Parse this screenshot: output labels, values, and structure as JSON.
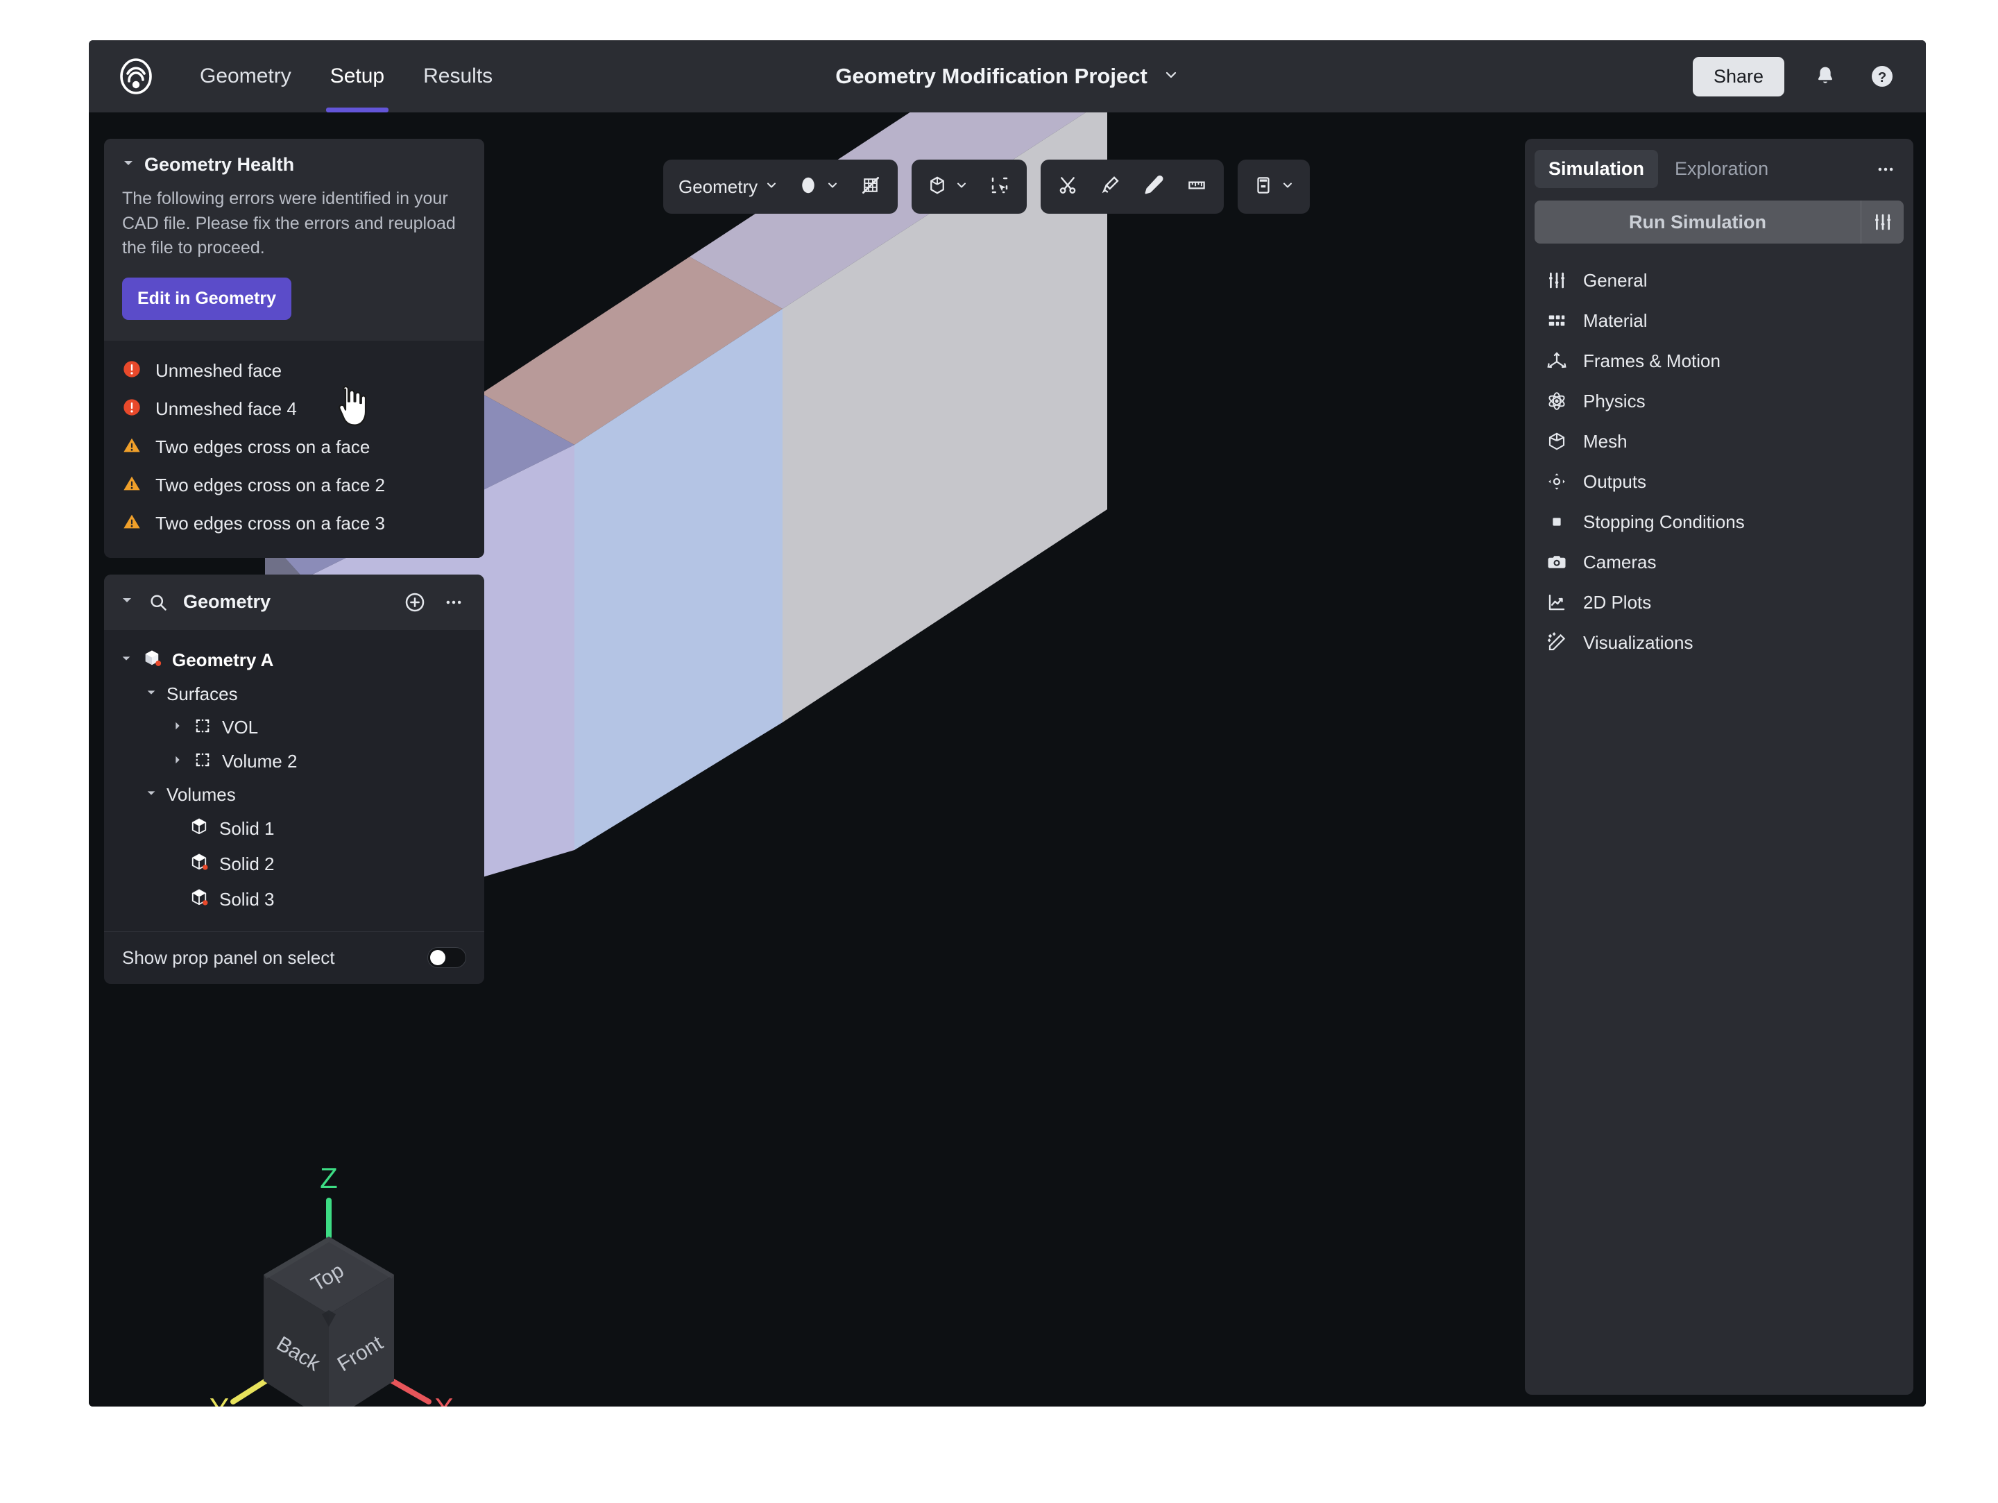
{
  "topbar": {
    "logo_icon": "luminary-logo-icon",
    "tabs": [
      {
        "label": "Geometry",
        "active": false
      },
      {
        "label": "Setup",
        "active": true
      },
      {
        "label": "Results",
        "active": false
      }
    ],
    "project_title": "Geometry Modification Project",
    "project_chevron_icon": "chevron-down-icon",
    "share_label": "Share",
    "bell_icon": "notification-bell-icon",
    "help_icon": "help-circle-icon"
  },
  "toolbar": {
    "groups": [
      {
        "items": [
          {
            "type": "dropdown",
            "label": "Geometry",
            "icon": "chevron-down-icon",
            "name": "geometry-mode-dropdown"
          },
          {
            "type": "dropdown",
            "label": "",
            "icon": "sphere-shading-icon",
            "name": "shading-mode-dropdown"
          },
          {
            "type": "button",
            "label": "",
            "icon": "mesh-off-icon",
            "name": "toggle-mesh-button"
          }
        ]
      },
      {
        "items": [
          {
            "type": "dropdown",
            "label": "",
            "icon": "volume-select-icon",
            "name": "selection-type-dropdown"
          },
          {
            "type": "button",
            "label": "",
            "icon": "box-select-icon",
            "name": "box-select-button"
          }
        ]
      },
      {
        "items": [
          {
            "type": "button",
            "label": "",
            "icon": "scissors-icon",
            "name": "cut-tool-button"
          },
          {
            "type": "button",
            "label": "",
            "icon": "knife-icon",
            "name": "knife-tool-button"
          },
          {
            "type": "button",
            "label": "",
            "icon": "pen-icon",
            "name": "pen-tool-button"
          },
          {
            "type": "button",
            "label": "",
            "icon": "ruler-icon",
            "name": "measure-tool-button"
          }
        ]
      },
      {
        "items": [
          {
            "type": "dropdown",
            "label": "",
            "icon": "clip-plane-icon",
            "name": "clip-plane-dropdown"
          }
        ]
      }
    ]
  },
  "geometry_health": {
    "collapse_icon": "caret-down-icon",
    "title": "Geometry Health",
    "description": "The following errors were identified in your CAD file. Please fix the errors and reupload the file to proceed.",
    "edit_button_label": "Edit in Geometry",
    "edit_button_color": "#5b4cc9",
    "error_color": "#e8492b",
    "warning_color": "#f0a02a",
    "issues": [
      {
        "severity": "error",
        "icon": "error-circle-icon",
        "label": "Unmeshed face"
      },
      {
        "severity": "error",
        "icon": "error-circle-icon",
        "label": "Unmeshed face 4"
      },
      {
        "severity": "warning",
        "icon": "warning-triangle-icon",
        "label": "Two edges cross on a face"
      },
      {
        "severity": "warning",
        "icon": "warning-triangle-icon",
        "label": "Two edges cross on a face 2"
      },
      {
        "severity": "warning",
        "icon": "warning-triangle-icon",
        "label": "Two edges cross on a face 3"
      }
    ]
  },
  "geometry_panel": {
    "collapse_icon": "caret-down-icon",
    "search_icon": "search-icon",
    "title": "Geometry",
    "add_icon": "plus-circle-icon",
    "more_icon": "ellipsis-icon",
    "tree": [
      {
        "label": "Geometry A",
        "depth": 0,
        "caret": "down",
        "icon": "solid-cube-icon",
        "badge": true,
        "bold": true
      },
      {
        "label": "Surfaces",
        "depth": 1,
        "caret": "down",
        "icon": "",
        "badge": false,
        "bold": false
      },
      {
        "label": "VOL",
        "depth": 2,
        "caret": "right",
        "icon": "surface-group-icon",
        "badge": false,
        "bold": false
      },
      {
        "label": "Volume 2",
        "depth": 2,
        "caret": "right",
        "icon": "surface-group-icon",
        "badge": false,
        "bold": false
      },
      {
        "label": "Volumes",
        "depth": 1,
        "caret": "down",
        "icon": "",
        "badge": false,
        "bold": false
      },
      {
        "label": "Solid 1",
        "depth": 2,
        "caret": "none",
        "icon": "solid-cube-icon",
        "badge": false,
        "bold": false
      },
      {
        "label": "Solid 2",
        "depth": 2,
        "caret": "none",
        "icon": "solid-cube-icon",
        "badge": true,
        "bold": false
      },
      {
        "label": "Solid 3",
        "depth": 2,
        "caret": "none",
        "icon": "solid-cube-icon",
        "badge": true,
        "bold": false
      }
    ],
    "prop_toggle_label": "Show prop panel on select",
    "prop_toggle_on": false
  },
  "right_panel": {
    "tabs": [
      {
        "label": "Simulation",
        "active": true
      },
      {
        "label": "Exploration",
        "active": false
      }
    ],
    "more_icon": "ellipsis-icon",
    "run_label": "Run Simulation",
    "run_settings_icon": "sliders-icon",
    "run_enabled": false,
    "items": [
      {
        "label": "General",
        "icon": "sliders-icon"
      },
      {
        "label": "Material",
        "icon": "material-grid-icon"
      },
      {
        "label": "Frames & Motion",
        "icon": "axes-icon"
      },
      {
        "label": "Physics",
        "icon": "atom-icon"
      },
      {
        "label": "Mesh",
        "icon": "cube-outline-icon"
      },
      {
        "label": "Outputs",
        "icon": "target-icon"
      },
      {
        "label": "Stopping Conditions",
        "icon": "stop-square-icon"
      },
      {
        "label": "Cameras",
        "icon": "camera-icon"
      },
      {
        "label": "2D Plots",
        "icon": "line-chart-icon"
      },
      {
        "label": "Visualizations",
        "icon": "magic-wand-icon"
      }
    ]
  },
  "viewport": {
    "background": "#0d1013",
    "cursor_icon": "pointing-hand-cursor",
    "gizmo": {
      "cube_faces": [
        "Top",
        "Back",
        "Front"
      ],
      "axes": [
        {
          "label": "Z",
          "color": "#4ade80"
        },
        {
          "label": "Y",
          "color": "#e8e35c"
        },
        {
          "label": "X",
          "color": "#e8555a"
        }
      ]
    },
    "model": {
      "name": "Geometry A",
      "faces": [
        {
          "name": "top-left-purple",
          "color": "#8b8cb8"
        },
        {
          "name": "top-mid-rose",
          "color": "#b89a99"
        },
        {
          "name": "top-right-lavender",
          "color": "#b8b2ca"
        },
        {
          "name": "front-left-lavender",
          "color": "#bcbade"
        },
        {
          "name": "front-mid-blue",
          "color": "#b4c4e4"
        },
        {
          "name": "front-right-grey",
          "color": "#c6c6cb"
        },
        {
          "name": "end-cap-dark",
          "color": "#6f7088"
        }
      ]
    }
  }
}
